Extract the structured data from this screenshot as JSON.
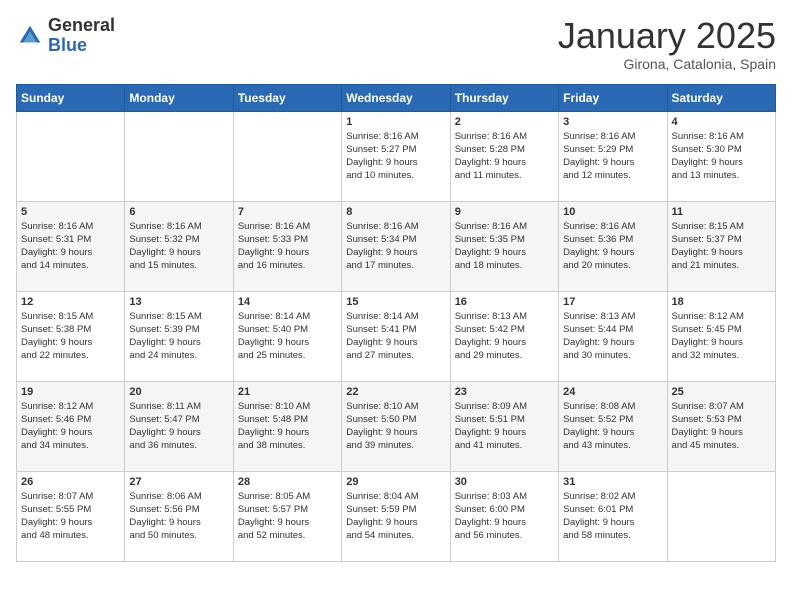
{
  "header": {
    "logo_general": "General",
    "logo_blue": "Blue",
    "month_title": "January 2025",
    "location": "Girona, Catalonia, Spain"
  },
  "weekdays": [
    "Sunday",
    "Monday",
    "Tuesday",
    "Wednesday",
    "Thursday",
    "Friday",
    "Saturday"
  ],
  "weeks": [
    [
      {
        "day": "",
        "info": ""
      },
      {
        "day": "",
        "info": ""
      },
      {
        "day": "",
        "info": ""
      },
      {
        "day": "1",
        "info": "Sunrise: 8:16 AM\nSunset: 5:27 PM\nDaylight: 9 hours\nand 10 minutes."
      },
      {
        "day": "2",
        "info": "Sunrise: 8:16 AM\nSunset: 5:28 PM\nDaylight: 9 hours\nand 11 minutes."
      },
      {
        "day": "3",
        "info": "Sunrise: 8:16 AM\nSunset: 5:29 PM\nDaylight: 9 hours\nand 12 minutes."
      },
      {
        "day": "4",
        "info": "Sunrise: 8:16 AM\nSunset: 5:30 PM\nDaylight: 9 hours\nand 13 minutes."
      }
    ],
    [
      {
        "day": "5",
        "info": "Sunrise: 8:16 AM\nSunset: 5:31 PM\nDaylight: 9 hours\nand 14 minutes."
      },
      {
        "day": "6",
        "info": "Sunrise: 8:16 AM\nSunset: 5:32 PM\nDaylight: 9 hours\nand 15 minutes."
      },
      {
        "day": "7",
        "info": "Sunrise: 8:16 AM\nSunset: 5:33 PM\nDaylight: 9 hours\nand 16 minutes."
      },
      {
        "day": "8",
        "info": "Sunrise: 8:16 AM\nSunset: 5:34 PM\nDaylight: 9 hours\nand 17 minutes."
      },
      {
        "day": "9",
        "info": "Sunrise: 8:16 AM\nSunset: 5:35 PM\nDaylight: 9 hours\nand 18 minutes."
      },
      {
        "day": "10",
        "info": "Sunrise: 8:16 AM\nSunset: 5:36 PM\nDaylight: 9 hours\nand 20 minutes."
      },
      {
        "day": "11",
        "info": "Sunrise: 8:15 AM\nSunset: 5:37 PM\nDaylight: 9 hours\nand 21 minutes."
      }
    ],
    [
      {
        "day": "12",
        "info": "Sunrise: 8:15 AM\nSunset: 5:38 PM\nDaylight: 9 hours\nand 22 minutes."
      },
      {
        "day": "13",
        "info": "Sunrise: 8:15 AM\nSunset: 5:39 PM\nDaylight: 9 hours\nand 24 minutes."
      },
      {
        "day": "14",
        "info": "Sunrise: 8:14 AM\nSunset: 5:40 PM\nDaylight: 9 hours\nand 25 minutes."
      },
      {
        "day": "15",
        "info": "Sunrise: 8:14 AM\nSunset: 5:41 PM\nDaylight: 9 hours\nand 27 minutes."
      },
      {
        "day": "16",
        "info": "Sunrise: 8:13 AM\nSunset: 5:42 PM\nDaylight: 9 hours\nand 29 minutes."
      },
      {
        "day": "17",
        "info": "Sunrise: 8:13 AM\nSunset: 5:44 PM\nDaylight: 9 hours\nand 30 minutes."
      },
      {
        "day": "18",
        "info": "Sunrise: 8:12 AM\nSunset: 5:45 PM\nDaylight: 9 hours\nand 32 minutes."
      }
    ],
    [
      {
        "day": "19",
        "info": "Sunrise: 8:12 AM\nSunset: 5:46 PM\nDaylight: 9 hours\nand 34 minutes."
      },
      {
        "day": "20",
        "info": "Sunrise: 8:11 AM\nSunset: 5:47 PM\nDaylight: 9 hours\nand 36 minutes."
      },
      {
        "day": "21",
        "info": "Sunrise: 8:10 AM\nSunset: 5:48 PM\nDaylight: 9 hours\nand 38 minutes."
      },
      {
        "day": "22",
        "info": "Sunrise: 8:10 AM\nSunset: 5:50 PM\nDaylight: 9 hours\nand 39 minutes."
      },
      {
        "day": "23",
        "info": "Sunrise: 8:09 AM\nSunset: 5:51 PM\nDaylight: 9 hours\nand 41 minutes."
      },
      {
        "day": "24",
        "info": "Sunrise: 8:08 AM\nSunset: 5:52 PM\nDaylight: 9 hours\nand 43 minutes."
      },
      {
        "day": "25",
        "info": "Sunrise: 8:07 AM\nSunset: 5:53 PM\nDaylight: 9 hours\nand 45 minutes."
      }
    ],
    [
      {
        "day": "26",
        "info": "Sunrise: 8:07 AM\nSunset: 5:55 PM\nDaylight: 9 hours\nand 48 minutes."
      },
      {
        "day": "27",
        "info": "Sunrise: 8:06 AM\nSunset: 5:56 PM\nDaylight: 9 hours\nand 50 minutes."
      },
      {
        "day": "28",
        "info": "Sunrise: 8:05 AM\nSunset: 5:57 PM\nDaylight: 9 hours\nand 52 minutes."
      },
      {
        "day": "29",
        "info": "Sunrise: 8:04 AM\nSunset: 5:59 PM\nDaylight: 9 hours\nand 54 minutes."
      },
      {
        "day": "30",
        "info": "Sunrise: 8:03 AM\nSunset: 6:00 PM\nDaylight: 9 hours\nand 56 minutes."
      },
      {
        "day": "31",
        "info": "Sunrise: 8:02 AM\nSunset: 6:01 PM\nDaylight: 9 hours\nand 58 minutes."
      },
      {
        "day": "",
        "info": ""
      }
    ]
  ]
}
